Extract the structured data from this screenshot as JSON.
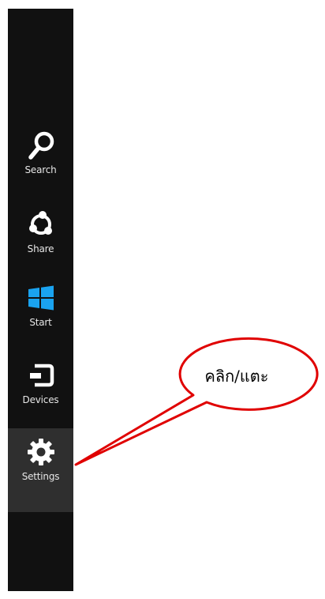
{
  "charms": {
    "search": {
      "label": "Search",
      "icon": "search-icon"
    },
    "share": {
      "label": "Share",
      "icon": "share-icon"
    },
    "start": {
      "label": "Start",
      "icon": "windows-logo-icon",
      "color": "#1aa3f0"
    },
    "devices": {
      "label": "Devices",
      "icon": "devices-icon"
    },
    "settings": {
      "label": "Settings",
      "icon": "gear-icon",
      "selected": true
    }
  },
  "callout": {
    "text": "คลิก/แตะ",
    "border_color": "#e00000"
  },
  "colors": {
    "bar_background": "#111111",
    "selected_background": "#2f2f2f",
    "icon_color": "#ffffff"
  }
}
